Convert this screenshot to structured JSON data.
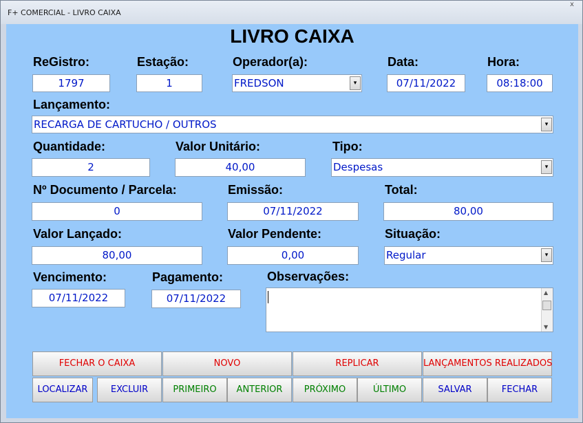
{
  "window": {
    "title": "F+ COMERCIAL - LIVRO CAIXA",
    "close_glyph": "x"
  },
  "heading": "LIVRO CAIXA",
  "labels": {
    "registro": "ReGistro:",
    "estacao": "Estação:",
    "operador": "Operador(a):",
    "data": "Data:",
    "hora": "Hora:",
    "lancamento": "Lançamento:",
    "quantidade": "Quantidade:",
    "valor_unitario": "Valor Unitário:",
    "tipo": "Tipo:",
    "documento": "Nº Documento / Parcela:",
    "emissao": "Emissão:",
    "total": "Total:",
    "valor_lancado": "Valor Lançado:",
    "valor_pendente": "Valor Pendente:",
    "situacao": "Situação:",
    "vencimento": "Vencimento:",
    "pagamento": "Pagamento:",
    "observacoes": "Observações:"
  },
  "values": {
    "registro": "1797",
    "estacao": "1",
    "operador": "FREDSON",
    "data": "07/11/2022",
    "hora": "08:18:00",
    "lancamento": "RECARGA DE CARTUCHO / OUTROS",
    "quantidade": "2",
    "valor_unitario": "40,00",
    "tipo": "Despesas",
    "documento": "0",
    "emissao": "07/11/2022",
    "total": "80,00",
    "valor_lancado": "80,00",
    "valor_pendente": "0,00",
    "situacao": "Regular",
    "vencimento": "07/11/2022",
    "pagamento": "07/11/2022",
    "observacoes": ""
  },
  "buttons": {
    "fechar_caixa": "FECHAR O CAIXA",
    "novo": "NOVO",
    "replicar": "REPLICAR",
    "lancamentos": "LANÇAMENTOS REALIZADOS",
    "localizar": "LOCALIZAR",
    "excluir": "EXCLUIR",
    "primeiro": "PRIMEIRO",
    "anterior": "ANTERIOR",
    "proximo": "PRÓXIMO",
    "ultimo": "ÚLTIMO",
    "salvar": "SALVAR",
    "fechar": "FECHAR"
  },
  "icons": {
    "dropdown": "▾",
    "scroll_up": "▲",
    "scroll_down": "▼"
  },
  "colors": {
    "background": "#98c9fa",
    "value_text": "#0018c8",
    "button_red": "#e00000",
    "button_blue": "#0000c8",
    "button_green": "#008000"
  }
}
